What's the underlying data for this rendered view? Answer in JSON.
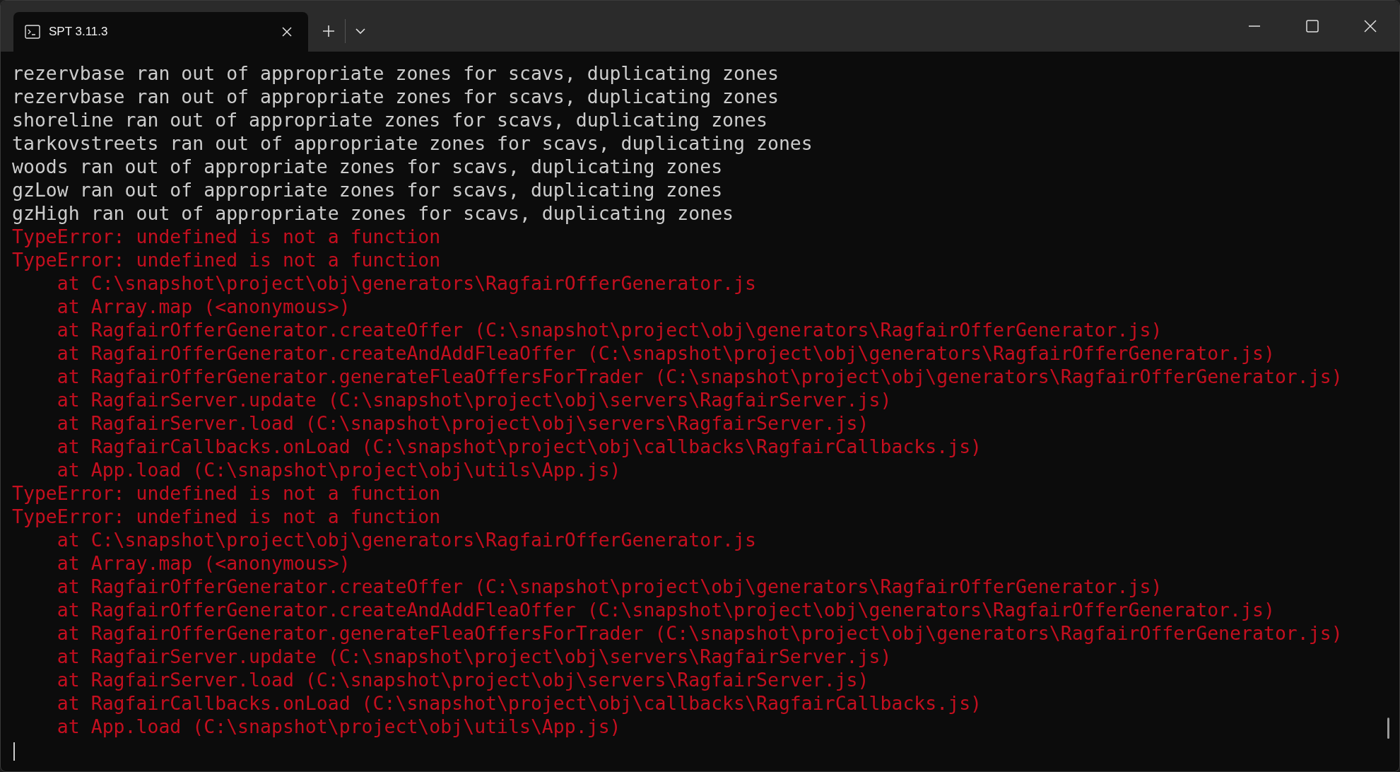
{
  "tabs": [
    {
      "label": "SPT 3.11.3",
      "selected": true
    }
  ],
  "lines": [
    {
      "kind": "info",
      "text": "rezervbase ran out of appropriate zones for scavs, duplicating zones"
    },
    {
      "kind": "info",
      "text": "rezervbase ran out of appropriate zones for scavs, duplicating zones"
    },
    {
      "kind": "info",
      "text": "shoreline ran out of appropriate zones for scavs, duplicating zones"
    },
    {
      "kind": "info",
      "text": "tarkovstreets ran out of appropriate zones for scavs, duplicating zones"
    },
    {
      "kind": "info",
      "text": "woods ran out of appropriate zones for scavs, duplicating zones"
    },
    {
      "kind": "info",
      "text": "gzLow ran out of appropriate zones for scavs, duplicating zones"
    },
    {
      "kind": "info",
      "text": "gzHigh ran out of appropriate zones for scavs, duplicating zones"
    },
    {
      "kind": "error",
      "text": "TypeError: undefined is not a function"
    },
    {
      "kind": "error",
      "text": "TypeError: undefined is not a function"
    },
    {
      "kind": "error",
      "text": "    at C:\\snapshot\\project\\obj\\generators\\RagfairOfferGenerator.js"
    },
    {
      "kind": "error",
      "text": "    at Array.map (<anonymous>)"
    },
    {
      "kind": "error",
      "text": "    at RagfairOfferGenerator.createOffer (C:\\snapshot\\project\\obj\\generators\\RagfairOfferGenerator.js)"
    },
    {
      "kind": "error",
      "text": "    at RagfairOfferGenerator.createAndAddFleaOffer (C:\\snapshot\\project\\obj\\generators\\RagfairOfferGenerator.js)"
    },
    {
      "kind": "error",
      "text": "    at RagfairOfferGenerator.generateFleaOffersForTrader (C:\\snapshot\\project\\obj\\generators\\RagfairOfferGenerator.js)"
    },
    {
      "kind": "error",
      "text": "    at RagfairServer.update (C:\\snapshot\\project\\obj\\servers\\RagfairServer.js)"
    },
    {
      "kind": "error",
      "text": "    at RagfairServer.load (C:\\snapshot\\project\\obj\\servers\\RagfairServer.js)"
    },
    {
      "kind": "error",
      "text": "    at RagfairCallbacks.onLoad (C:\\snapshot\\project\\obj\\callbacks\\RagfairCallbacks.js)"
    },
    {
      "kind": "error",
      "text": "    at App.load (C:\\snapshot\\project\\obj\\utils\\App.js)"
    },
    {
      "kind": "error",
      "text": "TypeError: undefined is not a function"
    },
    {
      "kind": "error",
      "text": "TypeError: undefined is not a function"
    },
    {
      "kind": "error",
      "text": "    at C:\\snapshot\\project\\obj\\generators\\RagfairOfferGenerator.js"
    },
    {
      "kind": "error",
      "text": "    at Array.map (<anonymous>)"
    },
    {
      "kind": "error",
      "text": "    at RagfairOfferGenerator.createOffer (C:\\snapshot\\project\\obj\\generators\\RagfairOfferGenerator.js)"
    },
    {
      "kind": "error",
      "text": "    at RagfairOfferGenerator.createAndAddFleaOffer (C:\\snapshot\\project\\obj\\generators\\RagfairOfferGenerator.js)"
    },
    {
      "kind": "error",
      "text": "    at RagfairOfferGenerator.generateFleaOffersForTrader (C:\\snapshot\\project\\obj\\generators\\RagfairOfferGenerator.js)"
    },
    {
      "kind": "error",
      "text": "    at RagfairServer.update (C:\\snapshot\\project\\obj\\servers\\RagfairServer.js)"
    },
    {
      "kind": "error",
      "text": "    at RagfairServer.load (C:\\snapshot\\project\\obj\\servers\\RagfairServer.js)"
    },
    {
      "kind": "error",
      "text": "    at RagfairCallbacks.onLoad (C:\\snapshot\\project\\obj\\callbacks\\RagfairCallbacks.js)"
    },
    {
      "kind": "error",
      "text": "    at App.load (C:\\snapshot\\project\\obj\\utils\\App.js)"
    }
  ]
}
